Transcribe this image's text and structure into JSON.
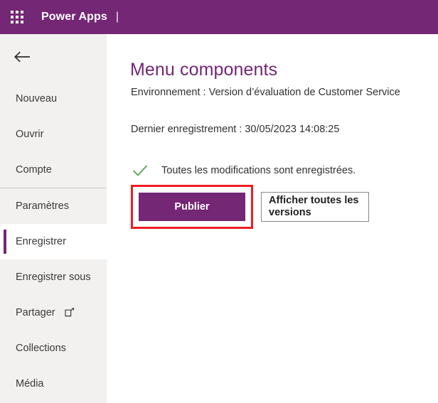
{
  "suitebar": {
    "waffle_icon": "app-launcher-waffle-icon",
    "brand": "Power Apps",
    "separator": "|"
  },
  "sidebar": {
    "back_icon": "back-arrow-icon",
    "items": [
      {
        "label": "Nouveau",
        "selected": false,
        "icon": null
      },
      {
        "label": "Ouvrir",
        "selected": false,
        "icon": null
      },
      {
        "label": "Compte",
        "selected": false,
        "icon": null
      },
      {
        "label": "Paramètres",
        "selected": false,
        "icon": null
      },
      {
        "label": "Enregistrer",
        "selected": true,
        "icon": null
      },
      {
        "label": "Enregistrer sous",
        "selected": false,
        "icon": null
      },
      {
        "label": "Partager",
        "selected": false,
        "icon": "external-link-icon"
      },
      {
        "label": "Collections",
        "selected": false,
        "icon": null
      },
      {
        "label": "Média",
        "selected": false,
        "icon": null
      }
    ],
    "divider_after_index": 2
  },
  "main": {
    "title": "Menu components",
    "environment": "Environnement : Version d’évaluation de Customer Service",
    "last_saved": "Dernier enregistrement : 30/05/2023 14:08:25",
    "status_icon": "green-checkmark-icon",
    "status_text": "Toutes les modifications sont enregistrées.",
    "publish_button": "Publier",
    "versions_button": "Afficher toutes les versions"
  },
  "colors": {
    "brand_purple": "#742774",
    "sidebar_bg": "#f2f1f0",
    "highlight_red": "#ee1d24",
    "success_green": "#5aa85a",
    "text_primary": "#323130"
  }
}
